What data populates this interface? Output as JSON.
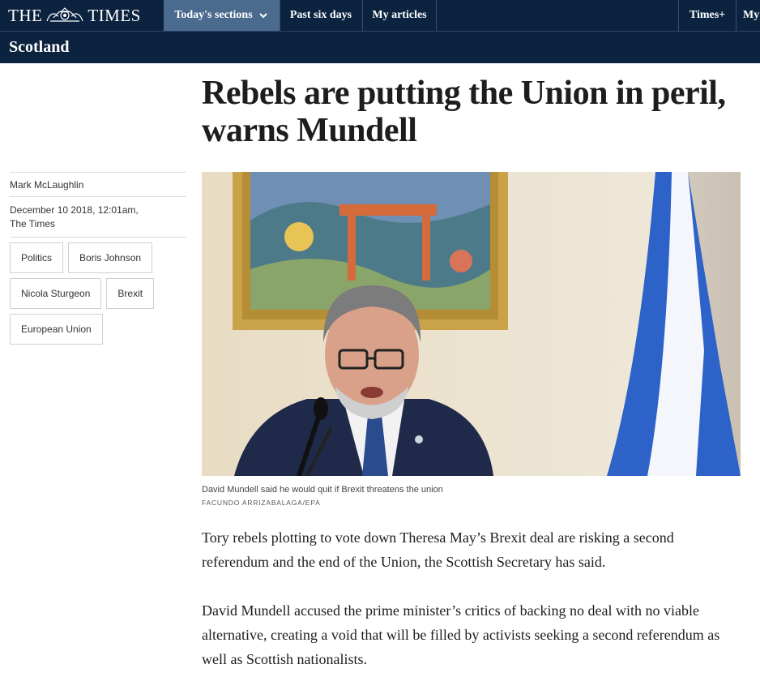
{
  "header": {
    "logo_left": "THE",
    "logo_right": "TIMES",
    "nav": [
      {
        "label": "Today's sections"
      },
      {
        "label": "Past six days"
      },
      {
        "label": "My articles"
      },
      {
        "label": "Times+"
      },
      {
        "label": "My"
      }
    ],
    "section_title": "Scotland"
  },
  "article": {
    "headline": "Rebels are putting the Union in peril, warns Mundell",
    "author": "Mark McLaughlin",
    "date": "December 10 2018, 12:01am,",
    "publication": "The Times",
    "tags": [
      "Politics",
      "Boris Johnson",
      "Nicola Sturgeon",
      "Brexit",
      "European Union"
    ],
    "image_caption": "David Mundell said he would quit if Brexit threatens the union",
    "image_credit": "FACUNDO ARRIZABALAGA/EPA",
    "paragraphs": [
      "Tory rebels plotting to vote down Theresa May’s Brexit deal are risking a second referendum and the end of the Union, the Scottish Secretary has said.",
      "David Mundell accused the prime minister’s critics of backing no deal with no viable alternative, creating a void that will be filled by activists seeking a second referendum as well as Scottish nationalists."
    ]
  },
  "colors": {
    "nav_bg": "#0c2340",
    "nav_active": "#4a6b8e",
    "text": "#1d1d1b"
  }
}
